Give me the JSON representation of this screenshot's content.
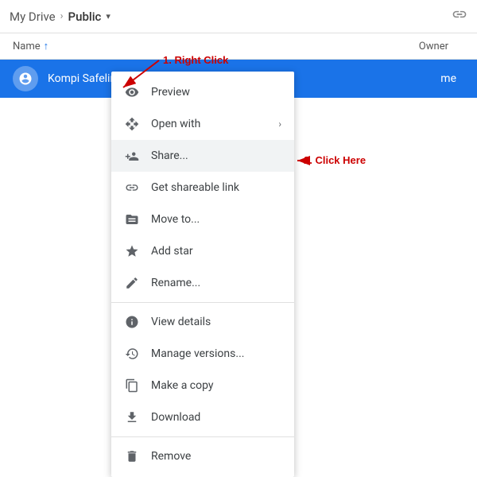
{
  "header": {
    "my_drive_label": "My Drive",
    "separator": "›",
    "public_label": "Public",
    "dropdown_icon": "▾",
    "link_icon": "⛓"
  },
  "columns": {
    "name_label": "Name",
    "sort_icon": "↑",
    "owner_label": "Owner"
  },
  "file_row": {
    "file_name": "Kompi Safelink",
    "owner": "me"
  },
  "annotations": {
    "right_click_label": "1. Right Click",
    "click_here_label": "2. Click Here"
  },
  "context_menu": {
    "items": [
      {
        "id": "preview",
        "label": "Preview",
        "icon": "eye",
        "has_arrow": false
      },
      {
        "id": "open-with",
        "label": "Open with",
        "icon": "open-with",
        "has_arrow": true
      },
      {
        "id": "share",
        "label": "Share...",
        "icon": "share",
        "has_arrow": false,
        "highlighted": true
      },
      {
        "id": "get-link",
        "label": "Get shareable link",
        "icon": "link",
        "has_arrow": false
      },
      {
        "id": "move-to",
        "label": "Move to...",
        "icon": "move",
        "has_arrow": false
      },
      {
        "id": "add-star",
        "label": "Add star",
        "icon": "star",
        "has_arrow": false
      },
      {
        "id": "rename",
        "label": "Rename...",
        "icon": "rename",
        "has_arrow": false
      },
      {
        "divider": true
      },
      {
        "id": "view-details",
        "label": "View details",
        "icon": "info",
        "has_arrow": false
      },
      {
        "id": "manage-versions",
        "label": "Manage versions...",
        "icon": "versions",
        "has_arrow": false
      },
      {
        "id": "make-copy",
        "label": "Make a copy",
        "icon": "copy",
        "has_arrow": false
      },
      {
        "id": "download",
        "label": "Download",
        "icon": "download",
        "has_arrow": false
      },
      {
        "divider2": true
      },
      {
        "id": "remove",
        "label": "Remove",
        "icon": "trash",
        "has_arrow": false
      }
    ]
  }
}
